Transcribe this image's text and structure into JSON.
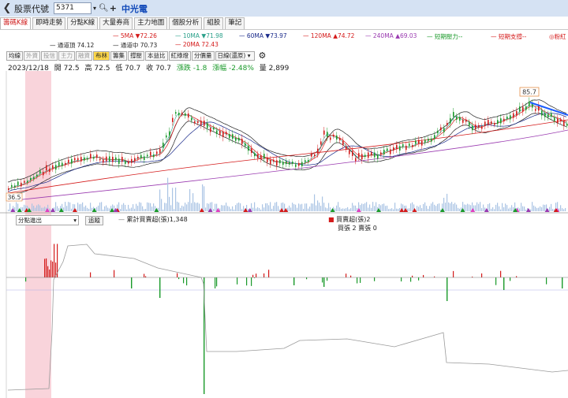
{
  "header": {
    "back_icon": "chevron-left-icon",
    "title": "股票代號",
    "stock_code": "5371",
    "stock_name": "中光電"
  },
  "tabs": [
    "籌碼K線",
    "即時走勢",
    "分點K線",
    "大量券商",
    "主力地圖",
    "個股分析",
    "組股",
    "筆記"
  ],
  "legend": {
    "ma5": "5MA ▼72.26",
    "ma10": "10MA ▼71.98",
    "ma60": "60MA ▼73.97",
    "ma120": "120MA ▲74.72",
    "ma240": "240MA ▲69.03",
    "short_pressure": "短期壓力--",
    "short_support": "短期支撐--",
    "right_label": "◎粉紅",
    "upper_band": "通道頂 74.12",
    "mid_band": "通道中 70.73",
    "ma20": "20MA 72.43"
  },
  "toolbar": [
    "均線",
    "外資",
    "投信",
    "主力",
    "融資",
    "布林",
    "籌集",
    "撐壓",
    "本益比",
    "紅綠燈",
    "分價量",
    "日線(還原)"
  ],
  "ohlc": {
    "date": "2023/12/18",
    "open": "開 72.5",
    "high": "高 72.5",
    "low": "低 70.7",
    "close": "收 70.7",
    "change": "漲跌 -1.8",
    "pct": "漲幅 -2.48%",
    "volume": "量 2,899"
  },
  "price_labels": {
    "high": "85.7",
    "low": "36.5"
  },
  "sub": {
    "select": "分點進出",
    "button": "追蹤",
    "cum_legend": "累計買賣超(張)1,348",
    "net_legend": "買賣超(張)2",
    "buy_sell": "買張 2 賣張 0"
  },
  "colors": {
    "up": "#d41a1a",
    "down": "#1a9a2a",
    "highlight": "#f7c6cf",
    "active_tab": "#d02020"
  }
}
